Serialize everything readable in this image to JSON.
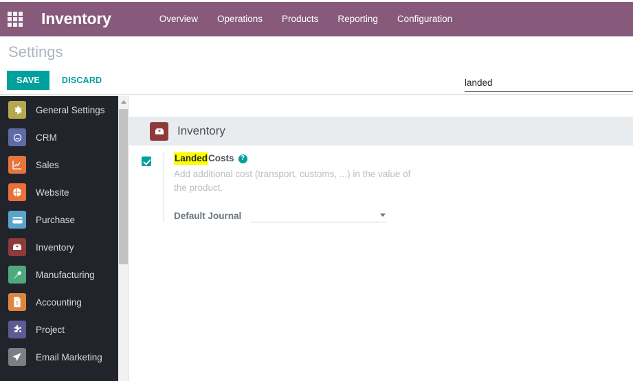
{
  "topbar": {
    "apps_icon": "apps-grid-icon",
    "brand": "Inventory",
    "menu": [
      {
        "label": "Overview"
      },
      {
        "label": "Operations"
      },
      {
        "label": "Products"
      },
      {
        "label": "Reporting"
      },
      {
        "label": "Configuration"
      }
    ],
    "bg_color": "#875A7B"
  },
  "controlpanel": {
    "title": "Settings",
    "save_label": "SAVE",
    "discard_label": "DISCARD",
    "accent_color": "#00A09D",
    "search": {
      "value": "landed",
      "placeholder": "Search..."
    }
  },
  "sidebar": {
    "items": [
      {
        "label": "General Settings",
        "icon": "gear-icon",
        "color": "#b6a84f"
      },
      {
        "label": "CRM",
        "icon": "crm-handshake-icon",
        "color": "#5f6aa8"
      },
      {
        "label": "Sales",
        "icon": "chart-line-icon",
        "color": "#e4763c"
      },
      {
        "label": "Website",
        "icon": "globe-icon",
        "color": "#e8703a"
      },
      {
        "label": "Purchase",
        "icon": "credit-card-icon",
        "color": "#5ba4c9"
      },
      {
        "label": "Inventory",
        "icon": "box-icon",
        "color": "#8f3a3a"
      },
      {
        "label": "Manufacturing",
        "icon": "wrench-icon",
        "color": "#4fa97e"
      },
      {
        "label": "Accounting",
        "icon": "invoice-icon",
        "color": "#e0853e"
      },
      {
        "label": "Project",
        "icon": "puzzle-icon",
        "color": "#5d5a96"
      },
      {
        "label": "Email Marketing",
        "icon": "paper-plane-icon",
        "color": "#7b7f85"
      }
    ]
  },
  "content": {
    "app_section": {
      "icon": "inventory-box-icon",
      "name": "Inventory",
      "band_color": "#E9ECEF"
    },
    "setting": {
      "checked": true,
      "title_highlight": "Landed",
      "title_rest": " Costs",
      "help_icon": "help-circle-icon",
      "description": "Add additional cost (transport, customs, ...) in the value of the product.",
      "journal": {
        "label": "Default Journal",
        "value": "",
        "placeholder": ""
      }
    }
  },
  "scrollbar": {
    "up_arrow": "scroll-up-arrow-icon"
  }
}
